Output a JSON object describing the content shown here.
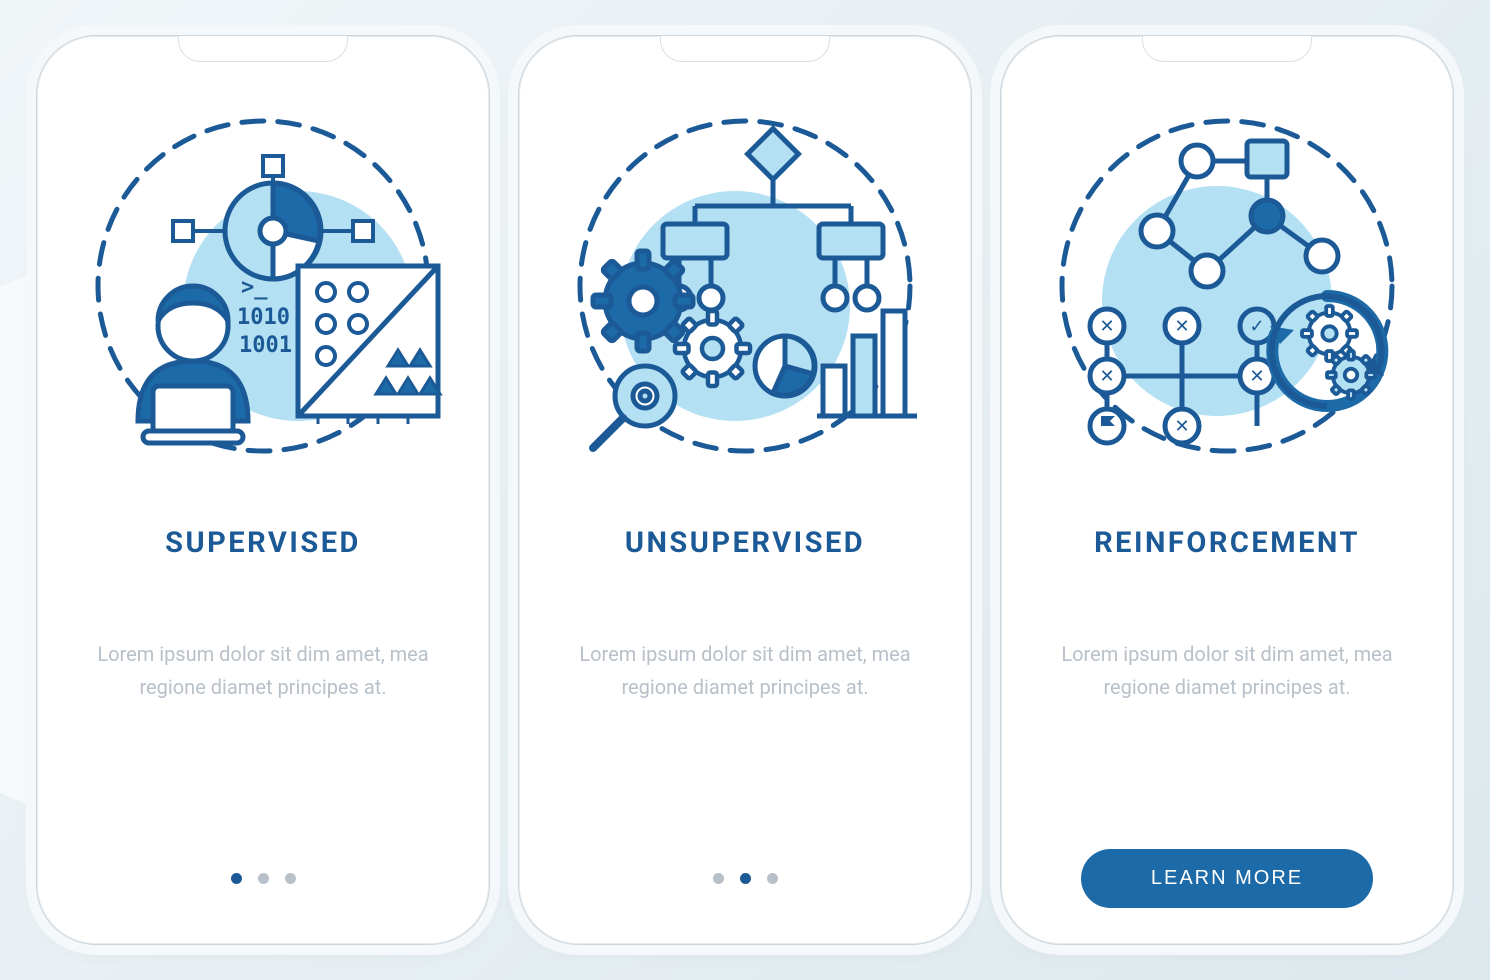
{
  "colors": {
    "primary": "#1b5a96",
    "lightBlue": "#b4e0f3",
    "bodyText": "#b8c0c9"
  },
  "screens": [
    {
      "id": "supervised",
      "title": "SUPERVISED",
      "body": "Lorem ipsum dolor sit dim amet, mea regione diamet principes at.",
      "icon": "supervised-learning-icon",
      "footer": "dots",
      "activeDot": 0
    },
    {
      "id": "unsupervised",
      "title": "UNSUPERVISED",
      "body": "Lorem ipsum dolor sit dim amet, mea regione diamet principes at.",
      "icon": "unsupervised-learning-icon",
      "footer": "dots",
      "activeDot": 1
    },
    {
      "id": "reinforcement",
      "title": "REINFORCEMENT",
      "body": "Lorem ipsum dolor sit dim amet, mea regione diamet principes at.",
      "icon": "reinforcement-learning-icon",
      "footer": "cta",
      "ctaLabel": "LEARN MORE"
    }
  ]
}
